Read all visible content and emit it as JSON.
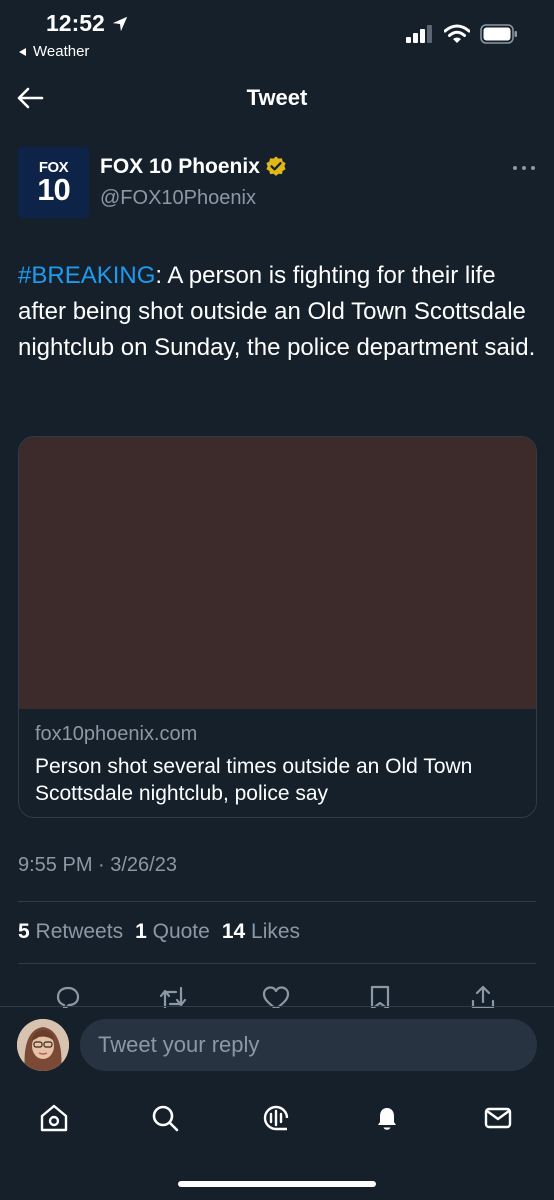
{
  "status_bar": {
    "time": "12:52",
    "back_app_label": "Weather"
  },
  "header": {
    "title": "Tweet"
  },
  "author": {
    "logo_text_top": "FOX",
    "logo_text_bottom": "10",
    "name": "FOX 10 Phoenix",
    "handle": "@FOX10Phoenix",
    "verified": true
  },
  "tweet": {
    "hashtag": "#BREAKING",
    "text": ": A person is fighting for their life after being shot outside an Old Town Scottsdale nightclub on Sunday, the police department said."
  },
  "card": {
    "domain": "fox10phoenix.com",
    "title": "Person shot several times outside an Old Town Scottsdale nightclub, police say"
  },
  "timestamp": "9:55 PM · 3/26/23",
  "stats": {
    "retweets_count": "5",
    "retweets_label": "Retweets",
    "quotes_count": "1",
    "quotes_label": "Quote",
    "likes_count": "14",
    "likes_label": "Likes"
  },
  "actions": [
    "reply-icon",
    "retweet-icon",
    "like-icon",
    "bookmark-icon",
    "share-icon"
  ],
  "reply": {
    "placeholder": "Tweet your reply"
  },
  "tabbar": [
    "home-icon",
    "search-icon",
    "spaces-icon",
    "notifications-icon",
    "messages-icon"
  ],
  "colors": {
    "background": "#15202b",
    "accent": "#1d9bf0",
    "secondary_text": "#8b98a5",
    "verified_badge": "#e2b719"
  }
}
